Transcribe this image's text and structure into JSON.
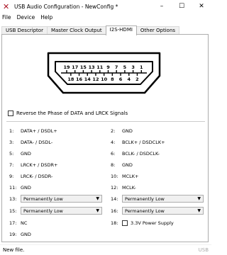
{
  "window": {
    "title": "USB Audio Configuration - NewConfig *",
    "minimize": "–",
    "maximize": "☐",
    "close": "✕"
  },
  "menu": [
    "File",
    "Device",
    "Help"
  ],
  "tabs": [
    "USB Descriptor",
    "Master Clock Output",
    "I2S-HDMI",
    "Other Options"
  ],
  "active_tab": "I2S-HDMI",
  "connector": {
    "top_pins": [
      "19",
      "17",
      "15",
      "13",
      "11",
      "9",
      "7",
      "5",
      "3",
      "1"
    ],
    "bottom_pins": [
      "18",
      "16",
      "14",
      "12",
      "10",
      "8",
      "6",
      "4",
      "2"
    ]
  },
  "reverse_phase_label": "Reverse the Phase of DATA and LRCK Signals",
  "pins_left": [
    {
      "num": "1:",
      "value": "DATA+ / DSDL+"
    },
    {
      "num": "3:",
      "value": "DATA- / DSDL-"
    },
    {
      "num": "5:",
      "value": "GND"
    },
    {
      "num": "7:",
      "value": "LRCK+ / DSDR+"
    },
    {
      "num": "9:",
      "value": "LRCK- / DSDR-"
    },
    {
      "num": "11:",
      "value": "GND"
    },
    {
      "num": "13:",
      "value": "Permanently Low"
    },
    {
      "num": "15:",
      "value": "Permanently Low"
    },
    {
      "num": "17:",
      "value": "NC"
    },
    {
      "num": "19:",
      "value": "GND"
    }
  ],
  "pins_right": [
    {
      "num": "2:",
      "value": "GND"
    },
    {
      "num": "4:",
      "value": "BCLK+ / DSDCLK+"
    },
    {
      "num": "6:",
      "value": "BCLK- / DSDCLK-"
    },
    {
      "num": "8:",
      "value": "GND"
    },
    {
      "num": "10:",
      "value": "MCLK+"
    },
    {
      "num": "12:",
      "value": "MCLK-"
    },
    {
      "num": "14:",
      "value": "Permanently Low"
    },
    {
      "num": "16:",
      "value": "Permanently Low"
    },
    {
      "num": "18:",
      "value": "3.3V Power Supply"
    }
  ],
  "status": {
    "left": "New file.",
    "right": "USB"
  }
}
